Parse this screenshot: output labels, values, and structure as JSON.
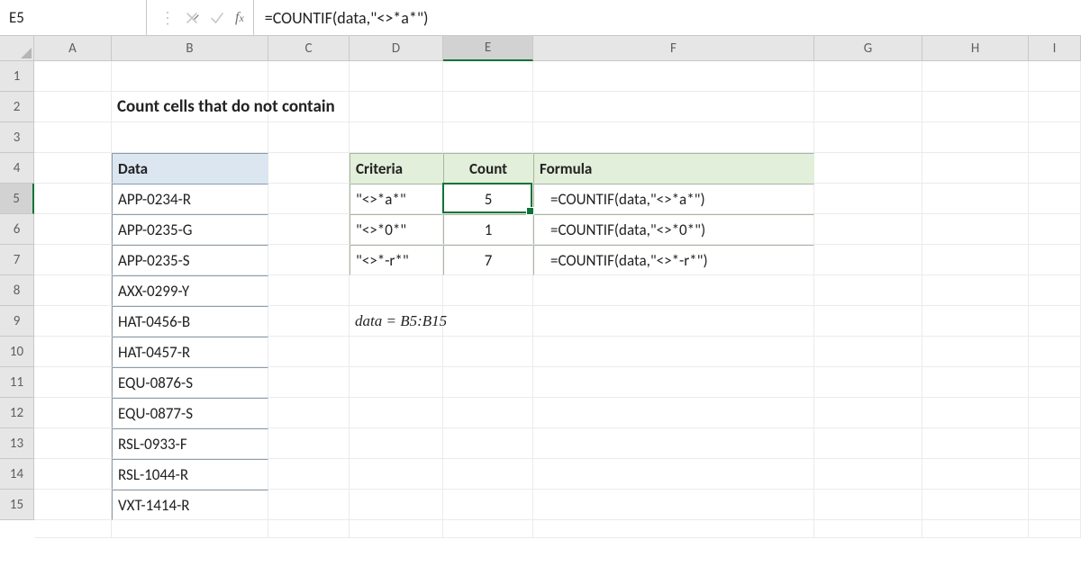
{
  "formula_bar": {
    "cell_ref": "E5",
    "formula": "=COUNTIF(data,\"<>*a*\")"
  },
  "columns": [
    "A",
    "B",
    "C",
    "D",
    "E",
    "F",
    "G",
    "H",
    "I"
  ],
  "rows": [
    "1",
    "2",
    "3",
    "4",
    "5",
    "6",
    "7",
    "8",
    "9",
    "10",
    "11",
    "12",
    "13",
    "14",
    "15"
  ],
  "title": "Count cells that do not contain",
  "data_header": "Data",
  "data_values": [
    "APP-0234-R",
    "APP-0235-G",
    "APP-0235-S",
    "AXX-0299-Y",
    "HAT-0456-B",
    "HAT-0457-R",
    "EQU-0876-S",
    "EQU-0877-S",
    "RSL-0933-F",
    "RSL-1044-R",
    "VXT-1414-R"
  ],
  "results": {
    "headers": {
      "criteria": "Criteria",
      "count": "Count",
      "formula": "Formula"
    },
    "rows": [
      {
        "criteria": "\"<>*a*\"",
        "count": "5",
        "formula": "=COUNTIF(data,\"<>*a*\")"
      },
      {
        "criteria": "\"<>*0*\"",
        "count": "1",
        "formula": "=COUNTIF(data,\"<>*0*\")"
      },
      {
        "criteria": "\"<>*-r*\"",
        "count": "7",
        "formula": "=COUNTIF(data,\"<>*-r*\")"
      }
    ]
  },
  "named_range_note": "data = B5:B15",
  "active_cell": "E5"
}
